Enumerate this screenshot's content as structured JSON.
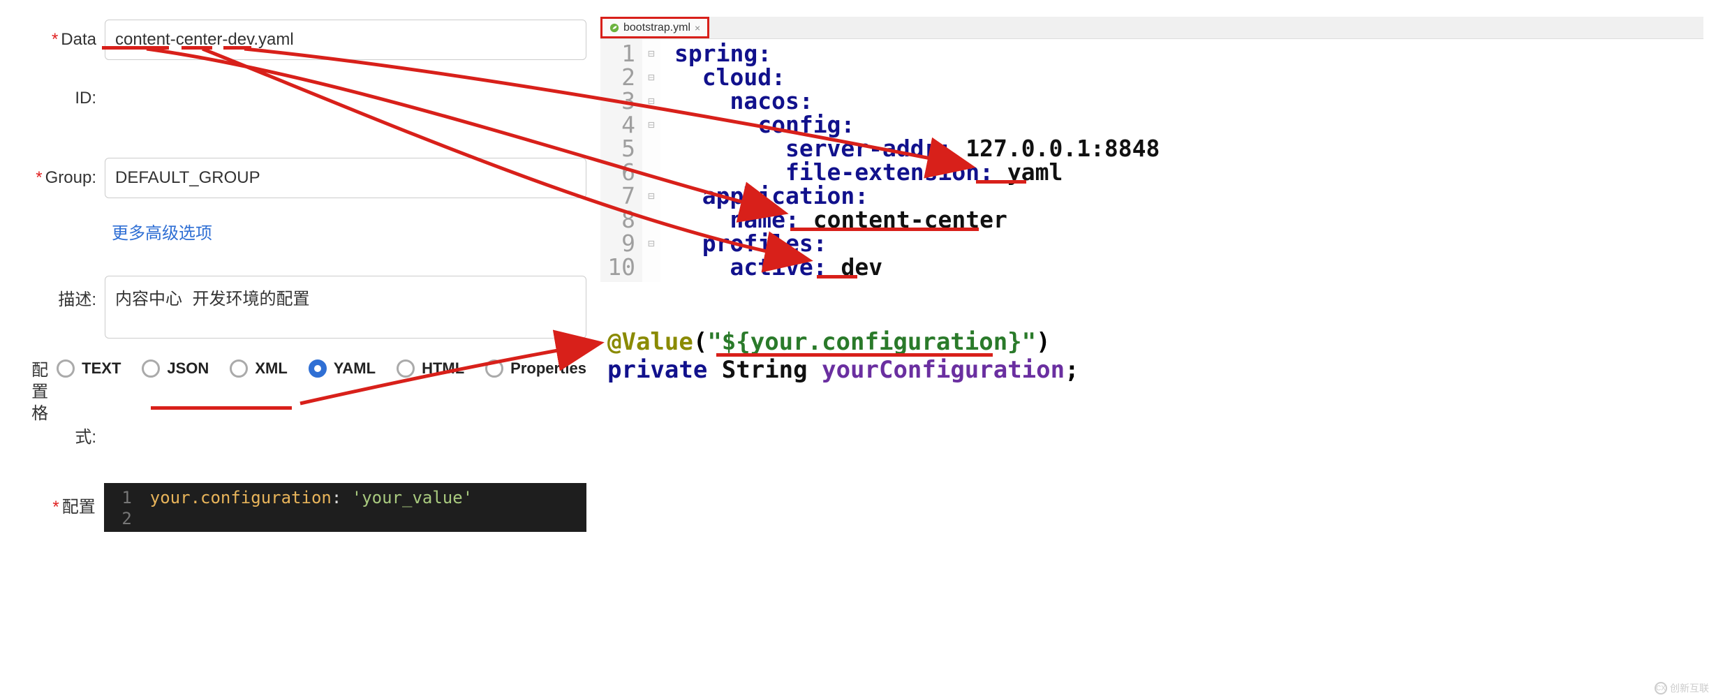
{
  "form": {
    "labels": {
      "data": "Data",
      "id": "ID:",
      "group": "Group:",
      "desc": "描述:",
      "format": "配置格",
      "format2": "式:",
      "config": "配置"
    },
    "data_value": "content-center-dev.yaml",
    "group_value": "DEFAULT_GROUP",
    "desc_value": "内容中心 开发环境的配置",
    "more_options": "更多高级选项",
    "formats": [
      "TEXT",
      "JSON",
      "XML",
      "YAML",
      "HTML",
      "Properties"
    ],
    "format_selected": "YAML"
  },
  "dark_editor": {
    "gutter": [
      "1",
      "2"
    ],
    "key": "your.configuration",
    "sep": ":",
    "value": "'your_value'"
  },
  "right": {
    "tab": "bootstrap.yml",
    "gutter": [
      "1",
      "2",
      "3",
      "4",
      "5",
      "6",
      "7",
      "8",
      "9",
      "10"
    ],
    "lines": {
      "l1": "spring",
      "l2": "cloud",
      "l3": "nacos",
      "l4": "config",
      "l5k": "server-addr",
      "l5v": "127.0.0.1:8848",
      "l6k": "file-extension",
      "l6v": "yaml",
      "l7": "application",
      "l8k": "name",
      "l8v": "content-center",
      "l9": "profiles",
      "l10k": "active",
      "l10v": "dev"
    }
  },
  "java": {
    "anno": "@Value",
    "open": "(",
    "str": "\"${your.configuration}\"",
    "close": ")",
    "priv": "private",
    "type": "String",
    "field": "yourConfiguration",
    "semi": ";"
  },
  "watermark": "创新互联"
}
